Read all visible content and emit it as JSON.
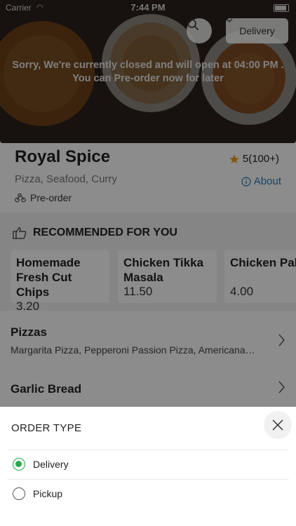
{
  "status_bar": {
    "carrier": "Carrier",
    "time": "7:44 PM"
  },
  "hero": {
    "delivery_label": "Delivery",
    "closed_line1": "Sorry, We're currently closed and will open at 04:00 PM .",
    "closed_line2": "You can Pre-order now for later"
  },
  "restaurant": {
    "name": "Royal Spice",
    "rating": "5(100+)",
    "cuisine": "Pizza, Seafood, Curry",
    "about_label": "About",
    "preorder_label": "Pre-order"
  },
  "recommended": {
    "title": "RECOMMENDED FOR YOU",
    "items": [
      {
        "name_line1": "Homemade",
        "name_line2": "Fresh Cut Chips",
        "price": "3.20"
      },
      {
        "name_line1": "Chicken Tikka",
        "name_line2": "Masala",
        "price": "11.50"
      },
      {
        "name_line1": "Chicken Pak",
        "name_line2": "",
        "price": "4.00"
      }
    ]
  },
  "categories": [
    {
      "title": "Pizzas",
      "subtitle": "Margarita Pizza, Pepperoni Passion Pizza, Americana…"
    },
    {
      "title": "Garlic Bread",
      "subtitle": ""
    }
  ],
  "order_sheet": {
    "title": "ORDER TYPE",
    "options": [
      {
        "label": "Delivery",
        "selected": true
      },
      {
        "label": "Pickup",
        "selected": false
      }
    ]
  },
  "colors": {
    "accent_green": "#2aa84a",
    "link_blue": "#2a7ab8",
    "star": "#e0a020"
  },
  "icons": [
    "search-icon",
    "chevron-down-icon",
    "star-icon",
    "info-icon",
    "bike-icon",
    "thumbs-up-icon",
    "chevron-right-icon",
    "close-icon"
  ]
}
